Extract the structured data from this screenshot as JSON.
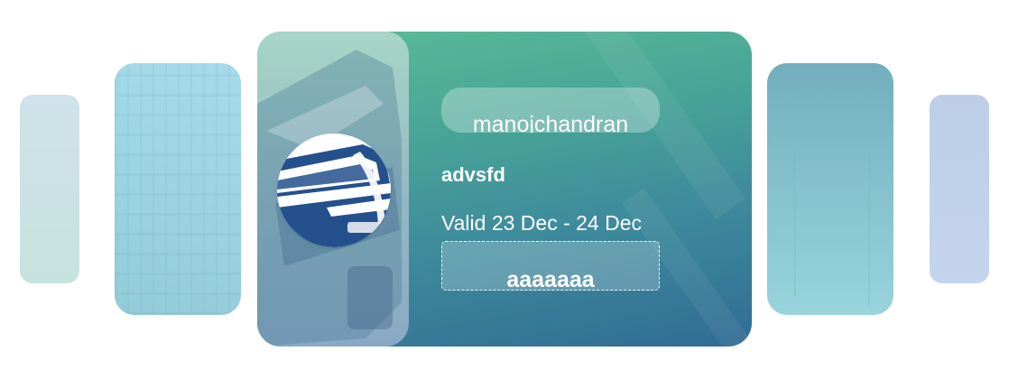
{
  "carousel": {
    "active_card": {
      "username": "manojchandran",
      "title": "advsfd",
      "validity": "Valid 23 Dec - 24 Dec",
      "code": "aaaaaaa",
      "logo_icon": "bus-icon"
    },
    "colors": {
      "main_gradient_top": "#5bbc96",
      "main_gradient_bottom": "#316c95",
      "logo_blue": "#24508c"
    }
  }
}
